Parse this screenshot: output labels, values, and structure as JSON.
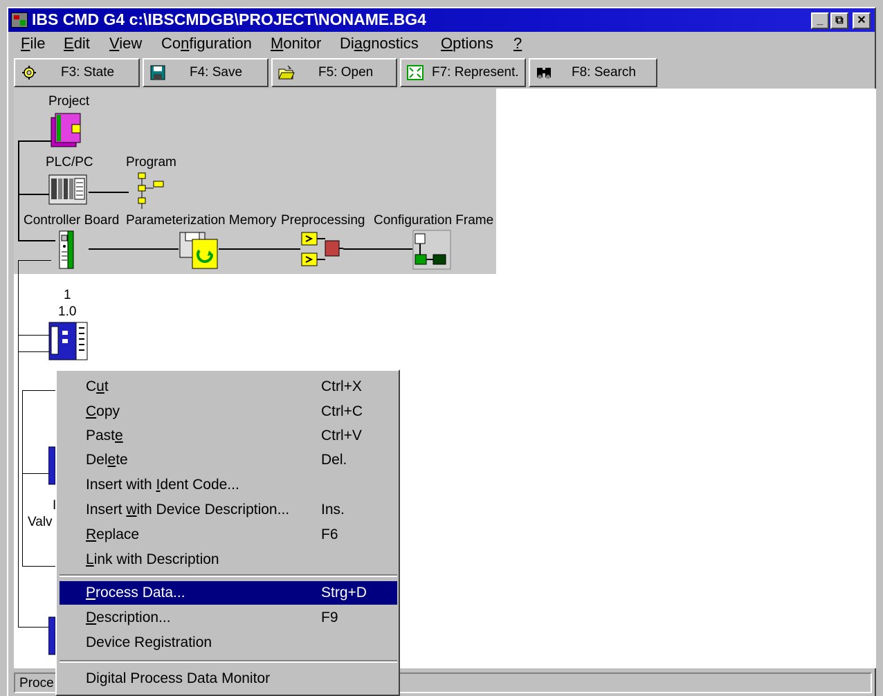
{
  "window": {
    "title": "IBS CMD G4 c:\\IBSCMDGB\\PROJECT\\NONAME.BG4",
    "controls": {
      "minimize": "_",
      "restore": "⧉",
      "close": "✕"
    }
  },
  "menubar": {
    "items": [
      {
        "pre": "",
        "u": "F",
        "post": "ile"
      },
      {
        "pre": "",
        "u": "E",
        "post": "dit"
      },
      {
        "pre": "",
        "u": "V",
        "post": "iew"
      },
      {
        "pre": "Co",
        "u": "n",
        "post": "figuration"
      },
      {
        "pre": "",
        "u": "M",
        "post": "onitor"
      },
      {
        "pre": "Di",
        "u": "a",
        "post": "gnostics"
      },
      {
        "pre": "",
        "u": "O",
        "post": "ptions"
      },
      {
        "pre": "",
        "u": "?",
        "post": ""
      }
    ]
  },
  "toolbar": {
    "state": "F3: State",
    "save": "F4: Save",
    "open": "F5: Open",
    "represent": "F7: Represent.",
    "search": "F8: Search"
  },
  "tree": {
    "project": "Project",
    "plc": "PLC/PC",
    "program": "Program",
    "controller_board": "Controller Board",
    "param_memory": "Parameterization Memory",
    "preprocessing": "Preprocessing",
    "config_frame": "Configuration Frame",
    "device_number": "1",
    "device_address": "1.0",
    "valve_partial": "Valv",
    "valve_mark": "I"
  },
  "context_menu": {
    "cut": {
      "pre": "C",
      "u": "u",
      "post": "t",
      "key": "Ctrl+X"
    },
    "copy": {
      "pre": "",
      "u": "C",
      "post": "opy",
      "key": "Ctrl+C"
    },
    "paste": {
      "pre": "Past",
      "u": "e",
      "post": "",
      "key": "Ctrl+V"
    },
    "delete": {
      "pre": "Del",
      "u": "e",
      "post": "te",
      "key": "Del."
    },
    "insert_ident": {
      "pre": "Insert with ",
      "u": "I",
      "post": "dent Code...",
      "key": ""
    },
    "insert_desc": {
      "pre": "Insert ",
      "u": "w",
      "post": "ith Device Description...",
      "key": "Ins."
    },
    "replace": {
      "pre": "",
      "u": "R",
      "post": "eplace",
      "key": "F6"
    },
    "link": {
      "pre": "",
      "u": "L",
      "post": "ink with Description",
      "key": ""
    },
    "process_data": {
      "pre": "",
      "u": "P",
      "post": "rocess Data...",
      "key": "Strg+D"
    },
    "description": {
      "pre": "",
      "u": "D",
      "post": "escription...",
      "key": "F9"
    },
    "device_registration": {
      "pre": "Device Registration",
      "u": "",
      "post": "",
      "key": ""
    },
    "digital_monitor": {
      "pre": "Digital Process Data Monitor",
      "u": "",
      "post": "",
      "key": ""
    }
  },
  "statusbar": {
    "text": "Proce"
  }
}
